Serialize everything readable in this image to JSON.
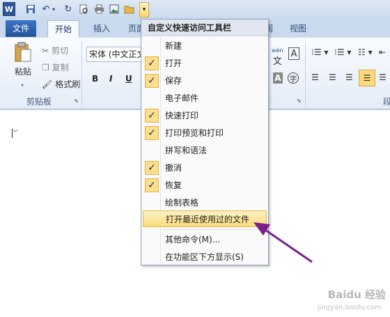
{
  "app": {
    "logo_letter": "W"
  },
  "quick_access": {
    "icons": [
      "save-icon",
      "undo-icon",
      "redo-icon",
      "print-preview-icon",
      "quick-print-icon",
      "picture-icon",
      "open-folder-icon",
      "customize-dropdown-icon"
    ]
  },
  "tabs": {
    "file": "文件",
    "home": "开始",
    "insert": "插入",
    "page_partial": "页面",
    "view_partial_left": "阅",
    "view": "视图"
  },
  "ribbon": {
    "clipboard": {
      "paste": "粘贴",
      "cut": "剪切",
      "copy": "复制",
      "format_painter": "格式刷",
      "group_label": "剪贴板"
    },
    "font": {
      "font_name": "宋体 (中文正文)",
      "bold": "B",
      "italic": "I",
      "underline": "U",
      "wen_label": "wén"
    },
    "paragraph": {
      "group_label_partial": "段"
    }
  },
  "menu": {
    "title": "自定义快速访问工具栏",
    "items": [
      {
        "label": "新建",
        "checked": false
      },
      {
        "label": "打开",
        "checked": true
      },
      {
        "label": "保存",
        "checked": true
      },
      {
        "label": "电子邮件",
        "checked": false
      },
      {
        "label": "快速打印",
        "checked": true
      },
      {
        "label": "打印预览和打印",
        "checked": true
      },
      {
        "label": "拼写和语法",
        "checked": false
      },
      {
        "label": "撤消",
        "checked": true
      },
      {
        "label": "恢复",
        "checked": true
      },
      {
        "label": "绘制表格",
        "checked": false
      },
      {
        "label": "打开最近使用过的文件",
        "checked": false,
        "highlighted": true
      }
    ],
    "more_commands": "其他命令(M)...",
    "show_below": "在功能区下方显示(S)",
    "check_glyph": "✓"
  },
  "watermark": {
    "text": "Baidu 经验",
    "url": "jingyan.baidu.com"
  },
  "colors": {
    "arrow": "#7a1f8c",
    "highlight": "#fbdc7c",
    "file_tab": "#2b5ba8"
  }
}
